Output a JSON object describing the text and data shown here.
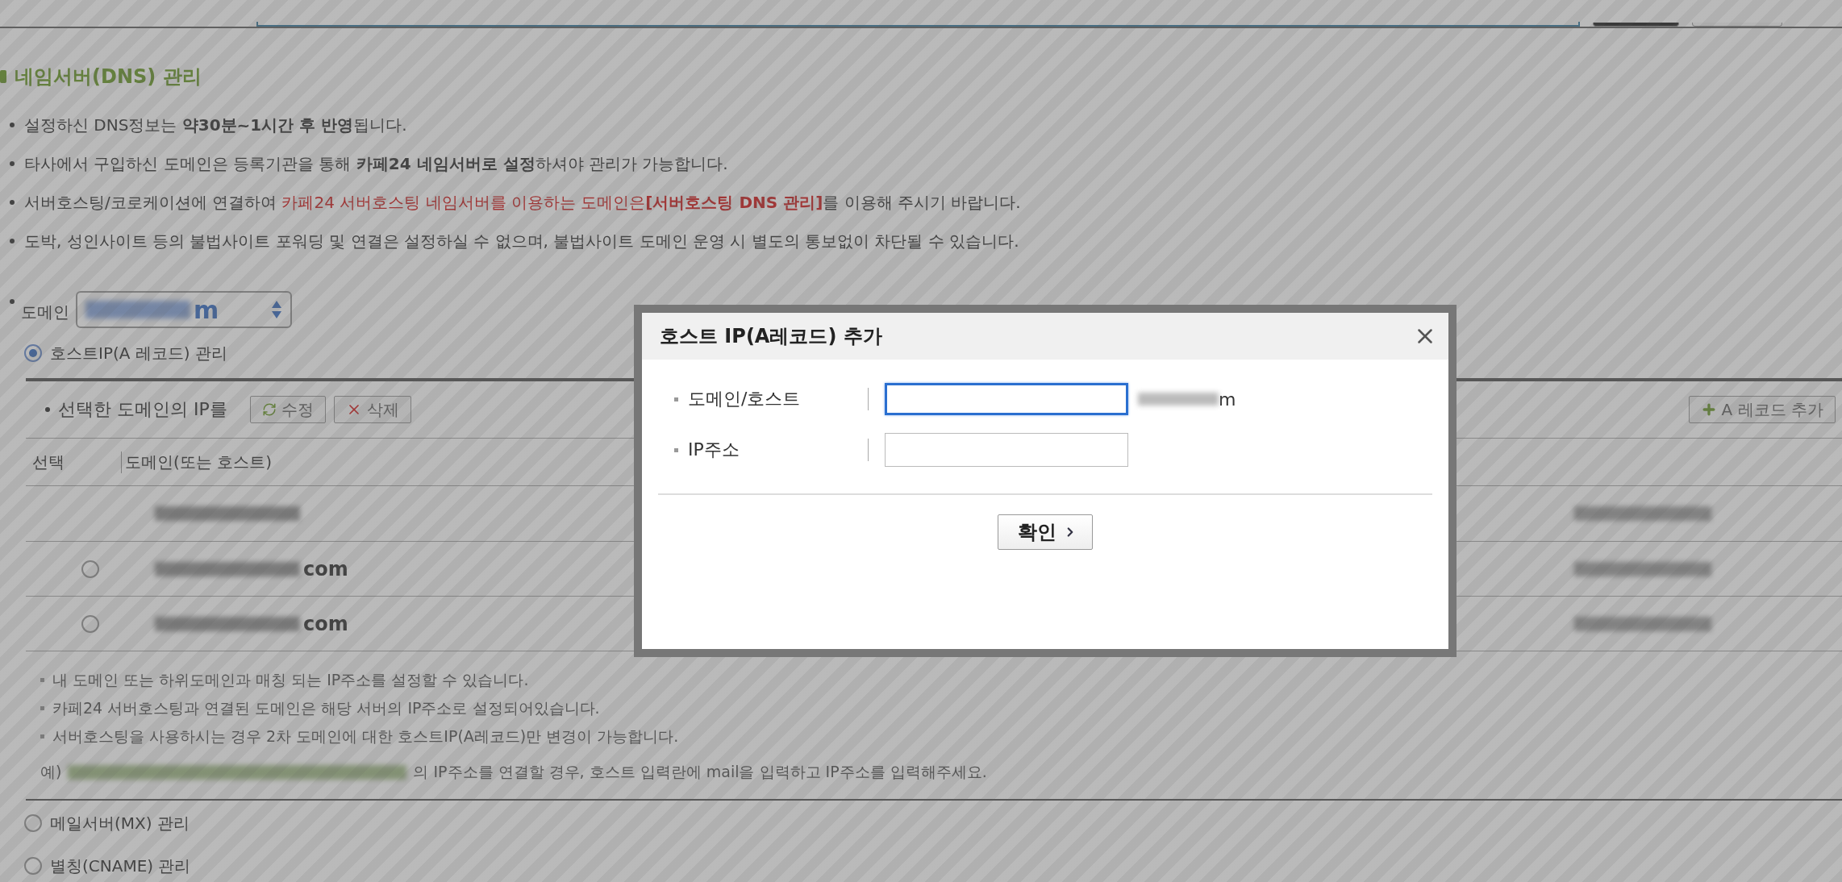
{
  "section": {
    "title": "네임서버(DNS) 관리"
  },
  "notices": [
    {
      "text": "설정하신 DNS정보는 **약30분~1시간 후 반영**됩니다."
    },
    {
      "text": "타사에서 구입하신 도메인은 등록기관을 통해 **카페24 네임서버로 설정**하셔야 관리가 가능합니다."
    },
    {
      "text": "서버호스팅/코로케이션에 연결하여 ",
      "highlight": "카페24 서버호스팅 네임서버를 이용하는 도메인은**[서버호스팅 DNS 관리]**",
      "after": "를 이용해 주시기 바랍니다."
    },
    {
      "text": "도박, 성인사이트 등의 불법사이트 포워딩 및 연결은 설정하실 수 없으며, 불법사이트 도메인 운영 시 별도의 통보없이 차단될 수 있습니다."
    }
  ],
  "domain_select": {
    "label": "도메인",
    "value_visible": "m"
  },
  "record_types": [
    {
      "label": "호스트IP(A 레코드) 관리",
      "selected": true
    },
    {
      "label": "메일서버(MX) 관리",
      "selected": false
    },
    {
      "label": "별칭(CNAME) 관리",
      "selected": false
    }
  ],
  "a_records": {
    "toolbar_label": "선택한 도메인의 IP를",
    "buttons": [
      {
        "label": "수정",
        "kind": "edit"
      },
      {
        "label": "삭제",
        "kind": "delete"
      }
    ],
    "add_button": "A 레코드 추가",
    "columns": [
      "선택",
      "도메인(또는 호스트)"
    ],
    "rows": [
      {
        "selectable": false
      },
      {
        "selectable": true,
        "selected": false,
        "host_visible": "com"
      },
      {
        "selectable": true,
        "selected": false,
        "host_visible": "com"
      }
    ],
    "notes": [
      "내 도메인 또는 하위도메인과 매칭 되는 IP주소를 설정할 수 있습니다.",
      "카페24 서버호스팅과 연결된 도메인은 해당 서버의 IP주소로 설정되어있습니다.",
      "서버호스팅을 사용하시는 경우 2차 도메인에 대한 호스트IP(A레코드)만 변경이 가능합니다."
    ],
    "example": {
      "prefix": "예)",
      "text": "의 IP주소를 연결할 경우, 호스트 입력란에 mail을 입력하고 IP주소를 입력해주세요."
    }
  },
  "dialog": {
    "title": "호스트 IP(A레코드) 추가",
    "fields": [
      {
        "label": "도메인/호스트",
        "focused": true,
        "suffix_visible": "m"
      },
      {
        "label": "IP주소",
        "focused": false
      }
    ],
    "confirm": "확인"
  }
}
